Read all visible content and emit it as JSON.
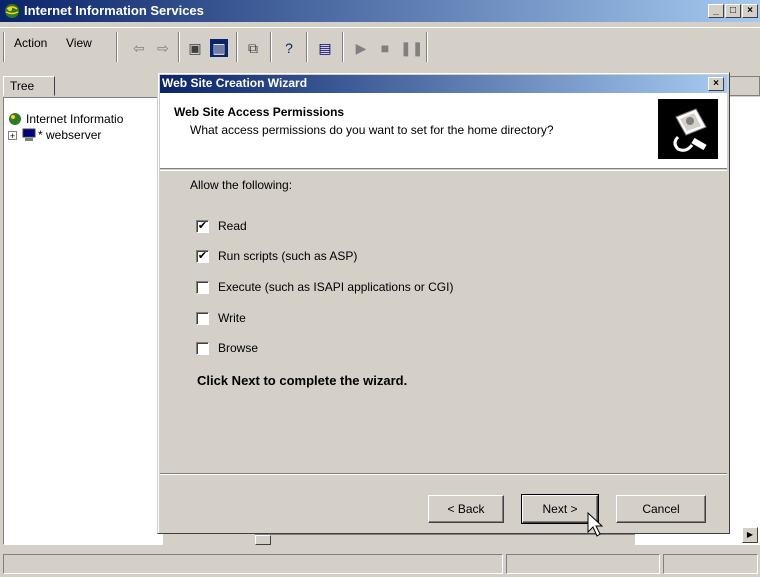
{
  "main_window": {
    "title": "Internet Information Services",
    "minimize": "_",
    "maximize": "□",
    "close": "×"
  },
  "menu": {
    "action": "Action",
    "view": "View"
  },
  "tree": {
    "tab_label": "Tree",
    "root": "Internet Informatio",
    "server": "* webserver"
  },
  "wizard": {
    "title": "Web Site Creation Wizard",
    "close": "×",
    "heading": "Web Site Access Permissions",
    "subheading": "What access permissions do you want to set for the home directory?",
    "allow_label": "Allow the following:",
    "permissions": [
      {
        "label": "Read",
        "checked": true
      },
      {
        "label": "Run scripts (such as ASP)",
        "checked": true
      },
      {
        "label": "Execute (such as ISAPI applications or CGI)",
        "checked": false
      },
      {
        "label": "Write",
        "checked": false
      },
      {
        "label": "Browse",
        "checked": false
      }
    ],
    "complete_text": "Click Next to complete the wizard.",
    "back_label": "< Back",
    "next_label": "Next >",
    "cancel_label": "Cancel"
  },
  "icons": {
    "app": "iis-globe-icon",
    "computer": "computer-icon",
    "wizard_header": "security-key-icon"
  },
  "colors": {
    "title_active_start": "#0a246a",
    "title_active_end": "#a6caf0",
    "face": "#d4d0c8"
  }
}
